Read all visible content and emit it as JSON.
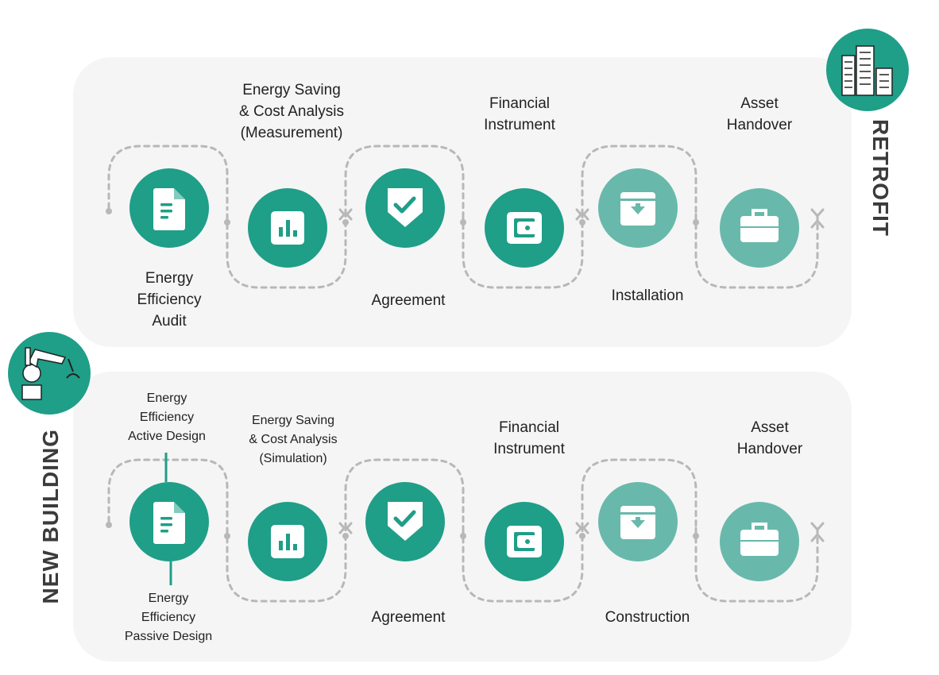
{
  "colors": {
    "dark": "#1f9e88",
    "light": "#68b9ab",
    "panel": "#f5f5f5",
    "dash": "#b8b8b8"
  },
  "retrofit": {
    "side_label": "RETROFIT",
    "icon": "city-buildings-icon",
    "steps": [
      {
        "lines": [
          "Energy",
          "Efficiency",
          "Audit"
        ],
        "icon": "document-icon"
      },
      {
        "lines": [
          "Energy Saving",
          "& Cost Analysis",
          "(Measurement)"
        ],
        "icon": "bar-chart-icon"
      },
      {
        "lines": [
          "Agreement"
        ],
        "icon": "shield-check-icon"
      },
      {
        "lines": [
          "Financial",
          "Instrument"
        ],
        "icon": "wallet-icon"
      },
      {
        "lines": [
          "Installation"
        ],
        "icon": "archive-box-icon"
      },
      {
        "lines": [
          "Asset",
          "Handover"
        ],
        "icon": "briefcase-icon"
      }
    ]
  },
  "new_building": {
    "side_label": "NEW BUILDING",
    "icon": "robot-arm-icon",
    "steps": [
      {
        "lines_top": [
          "Energy",
          "Efficiency",
          "Active Design"
        ],
        "lines_bottom": [
          "Energy",
          "Efficiency",
          "Passive Design"
        ],
        "icon": "document-icon"
      },
      {
        "lines": [
          "Energy Saving",
          "& Cost Analysis",
          "(Simulation)"
        ],
        "icon": "bar-chart-icon"
      },
      {
        "lines": [
          "Agreement"
        ],
        "icon": "shield-check-icon"
      },
      {
        "lines": [
          "Financial",
          "Instrument"
        ],
        "icon": "wallet-icon"
      },
      {
        "lines": [
          "Construction"
        ],
        "icon": "archive-box-icon"
      },
      {
        "lines": [
          "Asset",
          "Handover"
        ],
        "icon": "briefcase-icon"
      }
    ]
  }
}
